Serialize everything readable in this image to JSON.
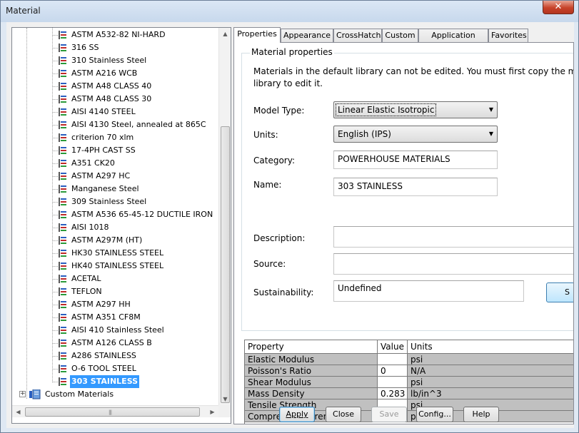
{
  "window": {
    "title": "Material",
    "close_glyph": "✕"
  },
  "tree": {
    "items": [
      "ASTM A532-82 NI-HARD",
      "316 SS",
      "310 Stainless Steel",
      "ASTM A216 WCB",
      "ASTM A48 CLASS 40",
      "ASTM A48 CLASS 30",
      "AISI 4140 STEEL",
      "AISI 4130 Steel, annealed at 865C",
      "criterion 70 xlm",
      "17-4PH CAST SS",
      "A351 CK20",
      "ASTM A297 HC",
      "Manganese Steel",
      "309 Stainless Steel",
      "ASTM A536 65-45-12 DUCTILE IRON",
      "AISI 1018",
      "ASTM A297M (HT)",
      "HK30 STAINLESS STEEL",
      "HK40 STAINLESS STEEL",
      "ACETAL",
      "TEFLON",
      "ASTM A297 HH",
      "ASTM A351 CF8M",
      "AISI 410 Stainless Steel",
      "ASTM A126 CLASS B",
      "A286 STAINLESS",
      "O-6 TOOL STEEL",
      "303 STAINLESS"
    ],
    "selected_index": 27,
    "custom_materials": "Custom Materials",
    "expander_glyph": "+"
  },
  "tabs": [
    "Properties",
    "Appearance",
    "CrossHatch",
    "Custom",
    "Application Data",
    "Favorites"
  ],
  "properties": {
    "group_title": "Material properties",
    "info_line1": "Materials in the default library can not be edited. You must first copy the m",
    "info_line2": "library to edit it.",
    "model_type_label": "Model Type:",
    "model_type_value": "Linear Elastic Isotropic",
    "units_label": "Units:",
    "units_value": "English (IPS)",
    "category_label": "Category:",
    "category_value": "POWERHOUSE MATERIALS",
    "name_label": "Name:",
    "name_value": "303 STAINLESS",
    "description_label": "Description:",
    "description_value": "",
    "source_label": "Source:",
    "source_value": "",
    "sustainability_label": "Sustainability:",
    "sustainability_value": "Undefined",
    "side_button_label": "S"
  },
  "grid": {
    "headers": [
      "Property",
      "Value",
      "Units"
    ],
    "rows": [
      {
        "property": "Elastic Modulus",
        "value": "",
        "units": "psi"
      },
      {
        "property": "Poisson's Ratio",
        "value": "0",
        "units": "N/A"
      },
      {
        "property": "Shear Modulus",
        "value": "",
        "units": "psi"
      },
      {
        "property": "Mass Density",
        "value": "0.283",
        "units": "lb/in^3"
      },
      {
        "property": "Tensile Strength",
        "value": "",
        "units": "psi"
      },
      {
        "property": "Compressive Strength",
        "value": "",
        "units": "psi"
      }
    ]
  },
  "buttons": {
    "apply": "Apply",
    "close": "Close",
    "save": "Save",
    "config": "Config...",
    "help": "Help"
  }
}
